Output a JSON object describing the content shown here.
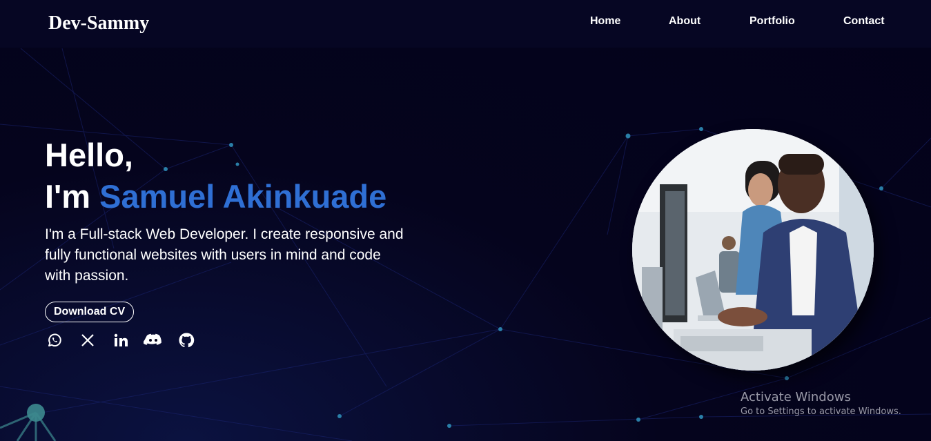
{
  "brand": {
    "logo_text": "Dev-Sammy"
  },
  "nav": {
    "items": [
      {
        "label": "Home"
      },
      {
        "label": "About"
      },
      {
        "label": "Portfolio"
      },
      {
        "label": "Contact"
      }
    ]
  },
  "hero": {
    "greeting": "Hello,",
    "intro_prefix": "I'm",
    "name": "Samuel Akinkuade",
    "description": "I'm a Full-stack Web Developer. I create responsive and fully functional websites with users in mind and code with passion.",
    "cv_button_label": "Download CV",
    "accent_color": "#2f6fd4"
  },
  "socials": [
    {
      "icon": "whatsapp-icon"
    },
    {
      "icon": "x-twitter-icon"
    },
    {
      "icon": "linkedin-icon"
    },
    {
      "icon": "discord-icon"
    },
    {
      "icon": "github-icon"
    }
  ],
  "profile_image": {
    "icon": "developer-photo"
  },
  "watermark": {
    "title": "Activate Windows",
    "subtitle": "Go to Settings to activate Windows."
  },
  "colors": {
    "background": "#04031a",
    "navbar": "#060623",
    "text": "#ffffff"
  }
}
